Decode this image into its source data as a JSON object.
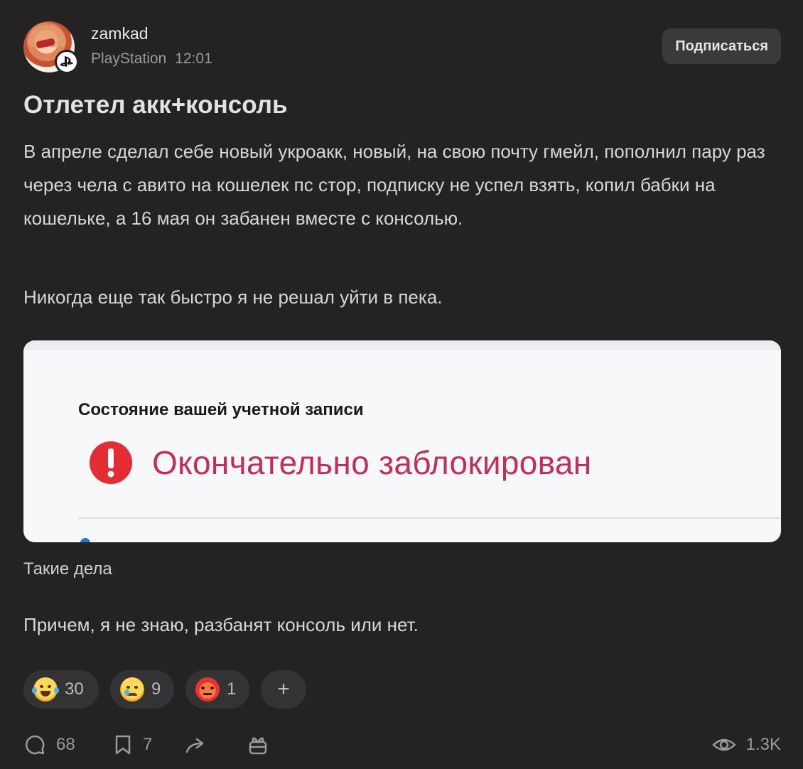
{
  "post": {
    "author": "zamkad",
    "community": "PlayStation",
    "time": "12:01",
    "subscribe_label": "Подписаться",
    "title": "Отлетел акк+консоль",
    "paragraph1": "В апреле сделал себе новый укроакк, новый, на свою почту гмейл, пополнил пару раз через чела с авито на кошелек пс стор, подписку не успел взять, копил бабки на кошельке, а 16 мая он забанен вместе с консолью.",
    "paragraph2": "Никогда еще так быстро я не решал уйти в пека.",
    "image": {
      "heading": "Состояние вашей учетной записи",
      "status": "Окончательно заблокирован",
      "status_color": "#c62d55"
    },
    "caption": "Такие дела",
    "paragraph3": "Причем, я не знаю, разбанят консоль или нет."
  },
  "reactions": [
    {
      "icon": "laughing-tears-emoji",
      "count": "30"
    },
    {
      "icon": "crying-face-emoji",
      "count": "9"
    },
    {
      "icon": "angry-face-emoji",
      "count": "1"
    }
  ],
  "add_reaction_label": "+",
  "footer": {
    "comments": "68",
    "bookmarks": "7",
    "views": "1.3K"
  }
}
